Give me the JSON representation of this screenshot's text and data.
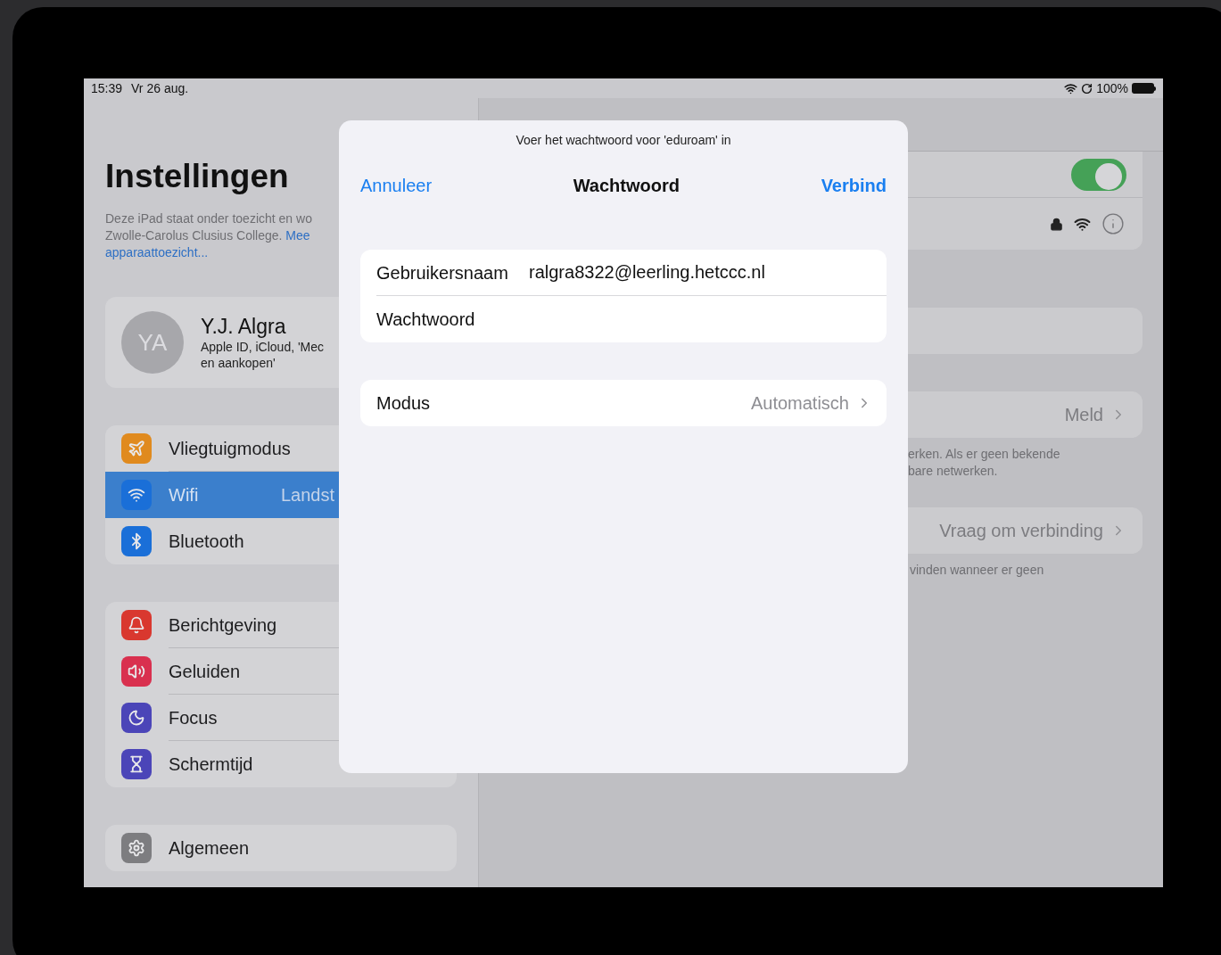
{
  "status_bar": {
    "time": "15:39",
    "date": "Vr 26 aug.",
    "battery": "100%"
  },
  "sidebar": {
    "title": "Instellingen",
    "notice": {
      "lines": [
        "Deze iPad staat onder toezicht en wo",
        "Zwolle-Carolus Clusius College."
      ],
      "link_lines": [
        "Mee",
        "apparaattoezicht..."
      ]
    },
    "profile": {
      "initials": "YA",
      "name": "Y.J. Algra",
      "subtitle_lines": [
        "Apple ID, iCloud, 'Mec",
        "en aankopen'"
      ]
    },
    "groups": [
      [
        {
          "label": "Vliegtuigmodus",
          "color": "#e08a1e",
          "selected": false
        },
        {
          "label": "Wifi",
          "value": "Landst",
          "color": "#1a6fd8",
          "selected": true
        },
        {
          "label": "Bluetooth",
          "color": "#1a6fd8",
          "selected": false
        }
      ],
      [
        {
          "label": "Berichtgeving",
          "color": "#d9382f",
          "selected": false
        },
        {
          "label": "Geluiden",
          "color": "#d9304f",
          "selected": false
        },
        {
          "label": "Focus",
          "color": "#4b45b8",
          "selected": false
        },
        {
          "label": "Schermtijd",
          "color": "#4b45b8",
          "selected": false
        }
      ],
      [
        {
          "label": "Algemeen",
          "color": "#7d7d80",
          "selected": false
        }
      ]
    ]
  },
  "detail": {
    "wifi_toggle": {
      "on": true
    },
    "ask_join": {
      "value": "Meld",
      "footnote_lines": [
        "erken. Als er geen bekende",
        "bare netwerken."
      ]
    },
    "auto_join": {
      "value": "Vraag om verbinding",
      "footnote_lines": [
        "vinden wanneer er geen"
      ]
    }
  },
  "dialog": {
    "prompt": "Voer het wachtwoord voor 'eduroam' in",
    "cancel": "Annuleer",
    "title": "Wachtwoord",
    "confirm": "Verbind",
    "fields": [
      {
        "label": "Gebruikersnaam",
        "value": "ralgra8322@leerling.hetccc.nl"
      },
      {
        "label": "Wachtwoord"
      }
    ],
    "mode": {
      "label": "Modus",
      "value": "Automatisch"
    }
  }
}
